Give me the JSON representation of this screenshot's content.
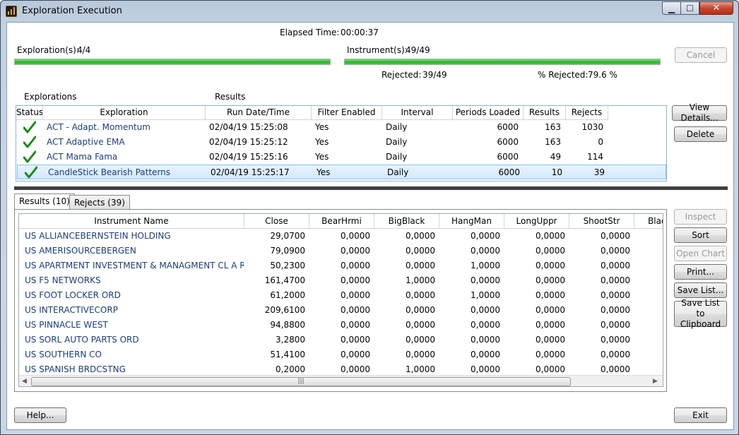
{
  "window": {
    "title": "Exploration Execution",
    "min_glyph": "▁",
    "max_glyph": "☐",
    "close_glyph": "✕"
  },
  "status": {
    "elapsed_label": "Elapsed Time:",
    "elapsed_value": "00:00:37",
    "explorations_label": "Exploration(s):",
    "explorations_value": "4/4",
    "explorations_progress": 1.0,
    "instruments_label": "Instrument(s):",
    "instruments_value": "49/49",
    "instruments_progress": 1.0,
    "rejected_label": "Rejected:",
    "rejected_value": "39/49",
    "pct_rejected_label": "% Rejected:",
    "pct_rejected_value": "79.6 %"
  },
  "buttons": {
    "cancel": "Cancel",
    "view_details": "View Details...",
    "delete": "Delete",
    "inspect": "Inspect",
    "sort": "Sort",
    "open_chart": "Open Chart",
    "print": "Print...",
    "save_list": "Save List...",
    "save_list_clipboard": "Save List to Clipboard",
    "help": "Help...",
    "exit": "Exit"
  },
  "explorations": {
    "section_label": "Explorations",
    "results_label": "Results",
    "columns": [
      "Status",
      "Exploration",
      "Run Date/Time",
      "Filter Enabled",
      "Interval",
      "Periods Loaded",
      "Results",
      "Rejects"
    ],
    "rows": [
      {
        "name": "ACT - Adapt. Momentum",
        "run": "02/04/19 15:25:08",
        "filter": "Yes",
        "interval": "Daily",
        "periods": "6000",
        "results": "163",
        "rejects": "1030",
        "status_icon": "check-icon"
      },
      {
        "name": "ACT Adaptive EMA",
        "run": "02/04/19 15:25:12",
        "filter": "Yes",
        "interval": "Daily",
        "periods": "6000",
        "results": "163",
        "rejects": "0",
        "status_icon": "check-icon"
      },
      {
        "name": "ACT Mama Fama",
        "run": "02/04/19 15:25:16",
        "filter": "Yes",
        "interval": "Daily",
        "periods": "6000",
        "results": "49",
        "rejects": "114",
        "status_icon": "check-icon"
      },
      {
        "name": "CandleStick Bearish Patterns",
        "run": "02/04/19 15:25:17",
        "filter": "Yes",
        "interval": "Daily",
        "periods": "6000",
        "results": "10",
        "rejects": "39",
        "status_icon": "check-icon",
        "selected": true
      }
    ]
  },
  "tabs": [
    {
      "label": "Results (10)",
      "active": true
    },
    {
      "label": "Rejects (39)",
      "active": false
    }
  ],
  "results": {
    "columns": [
      "Instrument Name",
      "Close",
      "BearHrmi",
      "BigBlack",
      "HangMan",
      "LongUppr",
      "ShootStr",
      "Blac"
    ],
    "rows": [
      [
        "US ALLIANCEBERNSTEIN HOLDING",
        "29,0700",
        "0,0000",
        "0,0000",
        "0,0000",
        "0,0000",
        "0,0000"
      ],
      [
        "US AMERISOURCEBERGEN",
        "79,0900",
        "0,0000",
        "0,0000",
        "0,0000",
        "0,0000",
        "0,0000"
      ],
      [
        "US APARTMENT INVESTMENT & MANAGMENT CL A REIT",
        "50,2300",
        "0,0000",
        "0,0000",
        "1,0000",
        "0,0000",
        "0,0000"
      ],
      [
        "US F5 NETWORKS",
        "161,4700",
        "0,0000",
        "1,0000",
        "0,0000",
        "0,0000",
        "0,0000"
      ],
      [
        "US FOOT LOCKER ORD",
        "61,2000",
        "0,0000",
        "0,0000",
        "1,0000",
        "0,0000",
        "0,0000"
      ],
      [
        "US INTERACTIVECORP",
        "209,6100",
        "0,0000",
        "0,0000",
        "0,0000",
        "0,0000",
        "0,0000"
      ],
      [
        "US PINNACLE WEST",
        "94,8800",
        "0,0000",
        "0,0000",
        "0,0000",
        "0,0000",
        "0,0000"
      ],
      [
        "US SORL AUTO PARTS ORD",
        "3,2800",
        "0,0000",
        "0,0000",
        "0,0000",
        "0,0000",
        "0,0000"
      ],
      [
        "US SOUTHERN CO",
        "51,4100",
        "0,0000",
        "0,0000",
        "0,0000",
        "0,0000",
        "0,0000"
      ],
      [
        "US SPANISH BRDCSTNG",
        "0,2000",
        "0,0000",
        "1,0000",
        "0,0000",
        "0,0000",
        "0,0000"
      ]
    ]
  },
  "scrollbar": {
    "left_arrow": "◀",
    "right_arrow": "▶",
    "grip": "|||"
  },
  "colors": {
    "accent_blue": "#1c3d7a",
    "progress_green": "#2fb52f",
    "check_green": "#1a8a1a"
  }
}
